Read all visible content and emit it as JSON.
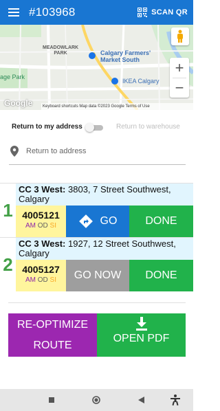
{
  "app": {
    "title": "#103968",
    "scan_label": "SCAN QR"
  },
  "map": {
    "labels": {
      "park_meadowlark": "MEADOWLARK\nPARK",
      "market": "Calgary Farmers'\nMarket South",
      "park_left": "age Park",
      "ikea": "IKEA Calgary"
    },
    "google": "Google",
    "attribution": "Keyboard shortcuts   Map data ©2023 Google   Terms of Use",
    "zoom_in": "+",
    "zoom_out": "−"
  },
  "options": {
    "return_to_my_address": "Return to my address",
    "return_to_warehouse": "Return to warehouse",
    "toggle_on": false
  },
  "address_field": {
    "placeholder": "Return to address"
  },
  "stops": [
    {
      "number": "1",
      "site": "CC 3 West:",
      "address": " 3803, 7 Street Southwest, Calgary",
      "id": "4005121",
      "flags": [
        "AM",
        "OD",
        "SI"
      ],
      "go_label": "GO",
      "done_label": "DONE"
    },
    {
      "number": "2",
      "site": "CC 3 West:",
      "address": " 1927, 12 Street Southwest, Calgary",
      "id": "4005127",
      "flags": [
        "AM",
        "OD",
        "SI"
      ],
      "go_label": "GO NOW",
      "done_label": "DONE"
    }
  ],
  "actions": {
    "reoptimize_line1": "RE-OPTIMIZE",
    "reoptimize_line2": "ROUTE",
    "open_pdf": "OPEN PDF"
  },
  "colors": {
    "appbar": "#1976d2",
    "go": "#1976d2",
    "go_now": "#9e9e9e",
    "done": "#21b24b",
    "reoptimize": "#9c27b0",
    "address_bg": "#e1f5fe",
    "id_bg": "#fff59d",
    "stop_number": "#43a047"
  },
  "icons": {
    "menu": "menu-icon",
    "scan": "qr-code-icon",
    "pegman": "street-view-icon",
    "pin": "location-pin-icon",
    "directions": "directions-icon",
    "download": "download-icon",
    "nav_recents": "square-icon",
    "nav_home": "circle-icon",
    "nav_back": "triangle-back-icon",
    "accessibility": "accessibility-icon"
  }
}
